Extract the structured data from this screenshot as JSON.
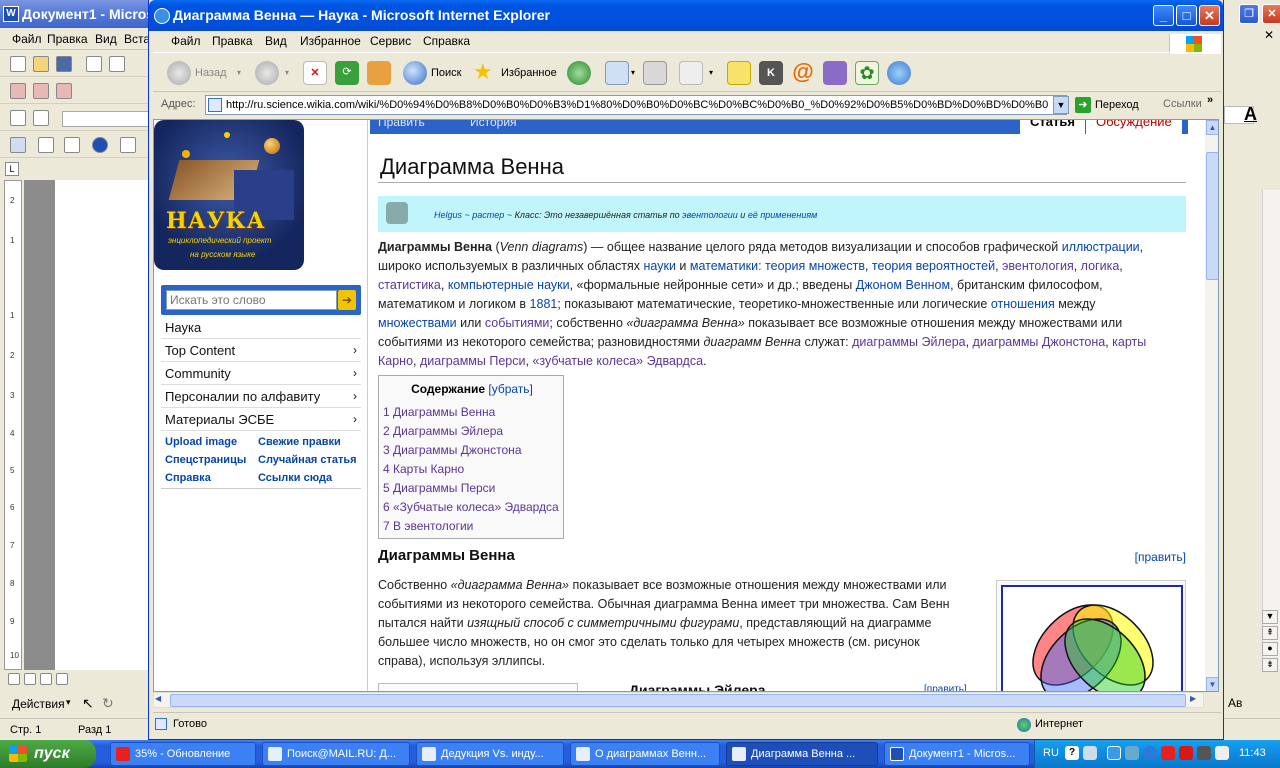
{
  "word": {
    "title": "Документ1 - Micros",
    "menu": [
      "Файл",
      "Правка",
      "Вид",
      "Вста"
    ],
    "status_page": "Стр. 1",
    "status_section": "Разд 1",
    "draw_actions": "Действия",
    "right_text": "Ав",
    "ruler_marks": [
      "2",
      "1",
      "1",
      "2",
      "3",
      "4",
      "5",
      "6",
      "7",
      "8",
      "9",
      "10"
    ]
  },
  "ie": {
    "title": "Диаграмма Венна — Наука - Microsoft Internet Explorer",
    "menu": [
      "Файл",
      "Правка",
      "Вид",
      "Избранное",
      "Сервис",
      "Справка"
    ],
    "toolbar": {
      "back": "Назад",
      "search": "Поиск",
      "favorites": "Избранное"
    },
    "address_label": "Адрес:",
    "url": "http://ru.science.wikia.com/wiki/%D0%94%D0%B8%D0%B0%D0%B3%D1%80%D0%B0%D0%BC%D0%BC%D0%B0_%D0%92%D0%B5%D0%BD%D0%BD%D0%B0",
    "go_label": "Переход",
    "links_label": "Ссылки",
    "status": "Готово",
    "zone": "Интернет"
  },
  "wiki": {
    "logo": {
      "title": "НАУКА",
      "subtitle": "энциклопедический проект",
      "subtitle2": "на русском языке"
    },
    "search_placeholder": "Искать это слово",
    "nav": [
      {
        "label": "Наука",
        "has_arrow": false
      },
      {
        "label": "Top Content",
        "has_arrow": true
      },
      {
        "label": "Community",
        "has_arrow": true
      },
      {
        "label": "Персоналии по алфавиту",
        "has_arrow": true
      },
      {
        "label": "Материалы ЭСБЕ",
        "has_arrow": true
      }
    ],
    "tools": [
      "Upload image",
      "Свежие правки",
      "Спецстраницы",
      "Случайная статья",
      "Справка",
      "Ссылки сюда"
    ],
    "tabs": {
      "edit": "Править",
      "history": "История",
      "article": "Статья",
      "discussion": "Обсуждение"
    },
    "title": "Диаграмма Венна",
    "stub": {
      "author": "Helgus",
      "sep1": " ~ ",
      "raster": "растер",
      "sep2": " ~ ",
      "text": "Класс: Это незавершённая статья по ",
      "link1": "эвентологии",
      "mid": " и ",
      "link2": "её применениям"
    },
    "intro": {
      "l1a": "Диаграммы Венна",
      "l1b": " (",
      "l1c": "Venn diagrams",
      "l1d": ") — общее название целого ряда методов визуализации и способов графической ",
      "l1e": "иллюстрации",
      "l1f": ",",
      "l2a": "широко используемых в различных областях ",
      "l2b": "науки",
      "l2c": " и ",
      "l2d": "математики: теория множеств",
      "l2e": ", ",
      "l2f": "теория вероятностей",
      "l2g": ", ",
      "l2h": "эвентология",
      "l2i": ", ",
      "l2j": "логика",
      "l2k": ",",
      "l3a": "статистика",
      "l3b": ", ",
      "l3c": "компьютерные науки",
      "l3d": ", «формальные нейронные сети» и др.; введены ",
      "l3e": "Джоном Венном",
      "l3f": ", британским философом,",
      "l4a": "математиком и логиком в ",
      "l4b": "1881",
      "l4c": "; показывают математические, теоретико-множественные или логические ",
      "l4d": "отношения",
      "l4e": " между",
      "l5a": "множествами",
      "l5b": " или ",
      "l5c": "событиями",
      "l5d": "; собственно ",
      "l5e": "«диаграмма Венна»",
      "l5f": " показывает все возможные отношения между множествами или",
      "l6a": "событиями из некоторого семейства; разновидностями ",
      "l6b": "диаграмм Венна",
      "l6c": " служат: ",
      "l6d": "диаграммы Эйлера",
      "l6e": ", ",
      "l6f": "диаграммы Джонстона",
      "l6g": ", ",
      "l6h": "карты",
      "l7a": "Карно",
      "l7b": ", ",
      "l7c": "диаграммы Перси",
      "l7d": ", ",
      "l7e": "«зубчатые колеса» Эдвардса",
      "l7f": "."
    },
    "toc": {
      "title": "Содержание",
      "hide": "[убрать]",
      "items": [
        "1 Диаграммы Венна",
        "2 Диаграммы Эйлера",
        "3 Диаграммы Джонстона",
        "4 Карты Карно",
        "5 Диаграммы Перси",
        "6 «Зубчатые колеса» Эдвардса",
        "7 В эвентологии"
      ]
    },
    "section": {
      "heading": "Диаграммы Венна",
      "edit": "[править]",
      "l1a": "Собственно ",
      "l1b": "«диаграмма Венна»",
      "l1c": " показывает все возможные отношения между множествами или",
      "l2": "событиями из некоторого семейства. Обычная диаграмма Венна имеет три множества. Сам Венн",
      "l3a": "пытался найти ",
      "l3b": "изящный способ с симметричными фигурами",
      "l3c": ", представляющий на диаграмме",
      "l4": "большее число множеств, но он смог это сделать только для четырех множеств (см. рисунок",
      "l5": "справа), используя эллипсы."
    },
    "next_heading": "Диаграммы Эйлера",
    "next_edit": "[править]"
  },
  "taskbar": {
    "start": "пуск",
    "tasks": [
      "35% - Обновление",
      "Поиск@MAIL.RU: Д...",
      "Дедукция Vs. инду...",
      "О диаграммах Венн...",
      "Диаграмма Венна ...",
      "Документ1 - Micros..."
    ],
    "lang": "RU",
    "time": "11:43"
  },
  "colors": {
    "xp_blue": "#245edc",
    "wiki_link": "#0645ad",
    "wiki_visited": "#5a3696",
    "stub_bg": "#bff5fb",
    "start_green": "#3c8f36"
  }
}
